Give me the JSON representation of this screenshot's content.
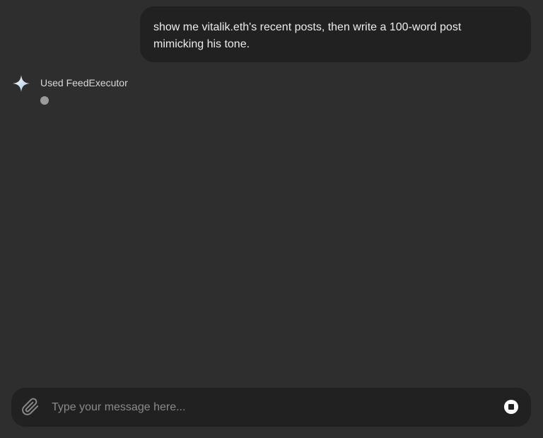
{
  "conversation": {
    "user_message": "show me vitalik.eth's recent posts, then write a 100-word post mimicking his tone.",
    "assistant": {
      "icon": "sparkle-icon",
      "tool_status": "Used FeedExecutor",
      "state": "typing"
    }
  },
  "composer": {
    "placeholder": "Type your message here...",
    "value": "",
    "attach_icon": "paperclip-icon",
    "stop_icon": "stop-icon"
  },
  "colors": {
    "background": "#2e2e2e",
    "bubble": "#212121",
    "text": "#ececec",
    "placeholder": "#8a8a8a",
    "sparkle": "#d6e6f5"
  }
}
